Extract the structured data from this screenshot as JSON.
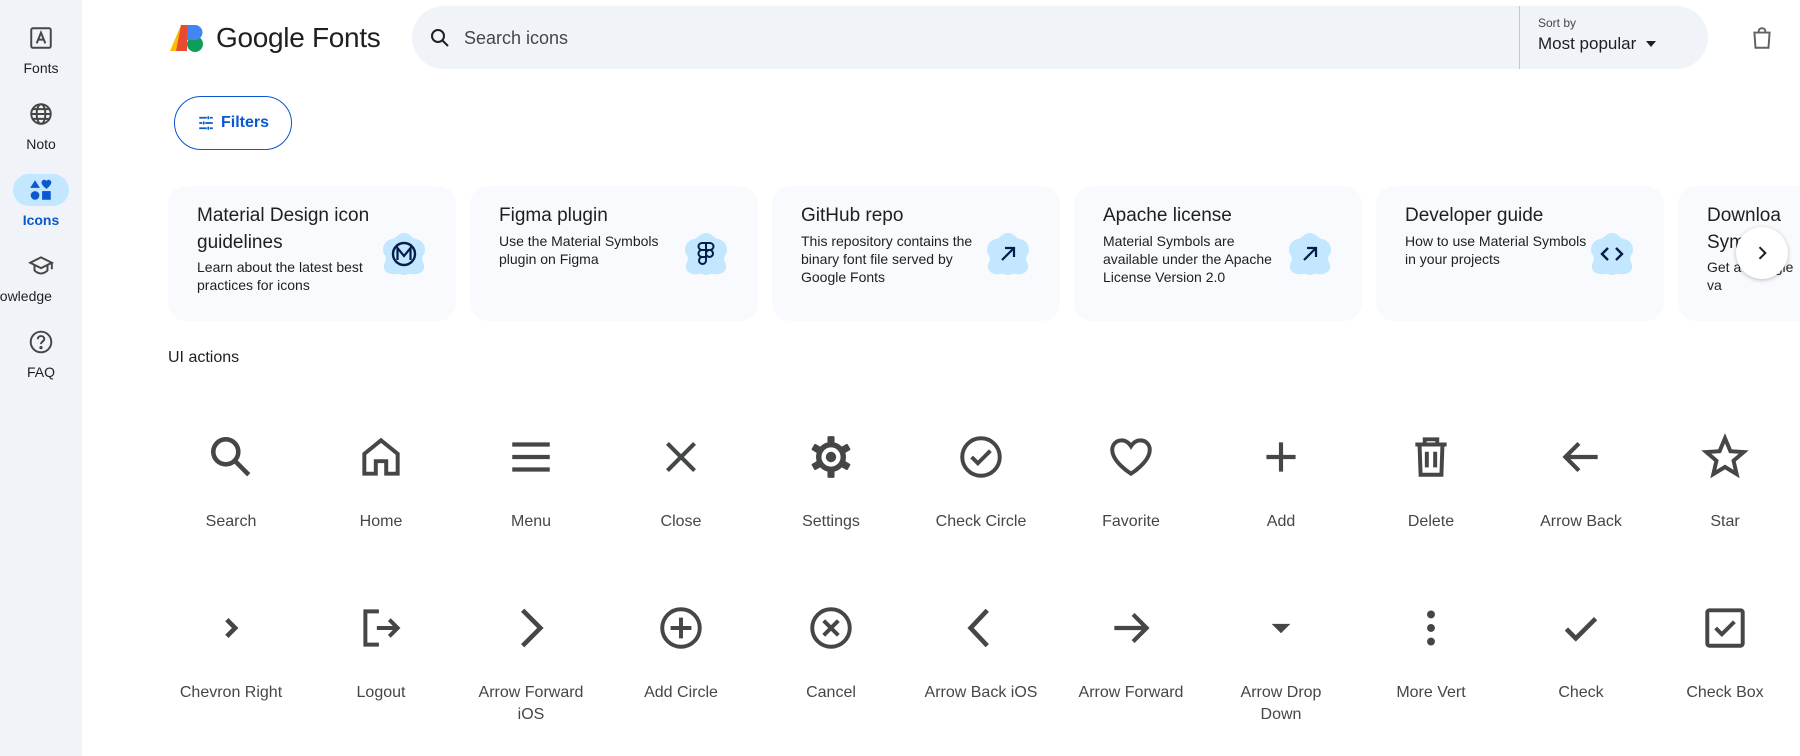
{
  "rail": {
    "items": [
      {
        "label": "Fonts",
        "icon": "font-icon"
      },
      {
        "label": "Noto",
        "icon": "globe-icon"
      },
      {
        "label": "Icons",
        "icon": "shapes-icon"
      },
      {
        "label": "nowledge",
        "icon": "school-icon"
      },
      {
        "label": "FAQ",
        "icon": "help-icon"
      }
    ]
  },
  "header": {
    "logo_text": "Google Fonts",
    "search_placeholder": "Search icons",
    "sort_label": "Sort by",
    "sort_value": "Most popular"
  },
  "filters_label": "Filters",
  "cards": [
    {
      "title": "Material Design icon guidelines",
      "desc": "Learn about the latest best practices for icons",
      "icon": "material-m-icon"
    },
    {
      "title": "Figma plugin",
      "desc": "Use the Material Symbols plugin on Figma",
      "icon": "figma-icon"
    },
    {
      "title": "GitHub repo",
      "desc": "This repository contains the binary font file served by Google Fonts",
      "icon": "arrow-outward-icon"
    },
    {
      "title": "Apache license",
      "desc": "Material Symbols are available under the Apache License Version 2.0",
      "icon": "arrow-outward-icon"
    },
    {
      "title": "Developer guide",
      "desc": "How to use Material Symbols in your projects",
      "icon": "code-icon"
    },
    {
      "title": "Downloa Sym",
      "desc": "Get a a single va",
      "icon": ""
    }
  ],
  "section_title": "UI actions",
  "icons_row1": [
    "Search",
    "Home",
    "Menu",
    "Close",
    "Settings",
    "Check Circle",
    "Favorite",
    "Add",
    "Delete",
    "Arrow Back",
    "Star"
  ],
  "icons_row2": [
    "Chevron Right",
    "Logout",
    "Arrow Forward iOS",
    "Add Circle",
    "Cancel",
    "Arrow Back iOS",
    "Arrow Forward",
    "Arrow Drop Down",
    "More Vert",
    "Check",
    "Check Box"
  ],
  "colors": {
    "accent": "#0b57d0",
    "rail_bg": "#f0f4f9",
    "active_pill": "#c2e7ff",
    "card_bg": "#f8fafd",
    "badge": "#c2e7ff",
    "icon": "#444746"
  }
}
